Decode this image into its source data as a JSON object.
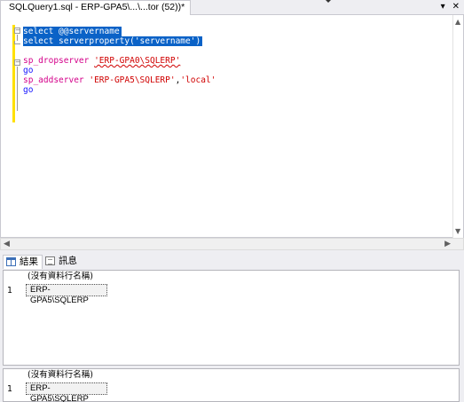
{
  "tab": {
    "title": "SQLQuery1.sql - ERP-GPA5\\...\\...tor (52))*",
    "dropdown_glyph": "▾",
    "close_glyph": "✕"
  },
  "editor": {
    "lines": [
      {
        "parts": [
          {
            "t": "select @@servername",
            "cls": "sel"
          }
        ]
      },
      {
        "parts": [
          {
            "t": "select serverproperty('servername')",
            "cls": "sel"
          }
        ]
      },
      {
        "parts": [
          {
            "t": "",
            "cls": ""
          }
        ]
      },
      {
        "parts": [
          {
            "t": "sp_dropserver ",
            "cls": "fn"
          },
          {
            "t": "'ERP-GPA0\\SQLERP'",
            "cls": "str red-sq"
          }
        ]
      },
      {
        "parts": [
          {
            "t": "go",
            "cls": "kw"
          }
        ]
      },
      {
        "parts": [
          {
            "t": "sp_addserver ",
            "cls": "fn"
          },
          {
            "t": "'ERP-GPA5\\SQLERP'",
            "cls": "str"
          },
          {
            "t": ",",
            "cls": ""
          },
          {
            "t": "'local'",
            "cls": "str"
          }
        ]
      },
      {
        "parts": [
          {
            "t": "go",
            "cls": "kw"
          }
        ]
      }
    ]
  },
  "results_tabs": {
    "results_label": "結果",
    "messages_label": "訊息"
  },
  "grids": [
    {
      "column_header": "(沒有資料行名稱)",
      "row_number": "1",
      "value": "ERP-GPA5\\SQLERP"
    },
    {
      "column_header": "(沒有資料行名稱)",
      "row_number": "1",
      "value": "ERP-GPA5\\SQLERP"
    }
  ],
  "colors": {
    "selection": "#0a62c7",
    "keyword": "#1414ff",
    "string": "#d00000",
    "system_proc": "#d4008a",
    "change_margin": "#ffe000"
  }
}
